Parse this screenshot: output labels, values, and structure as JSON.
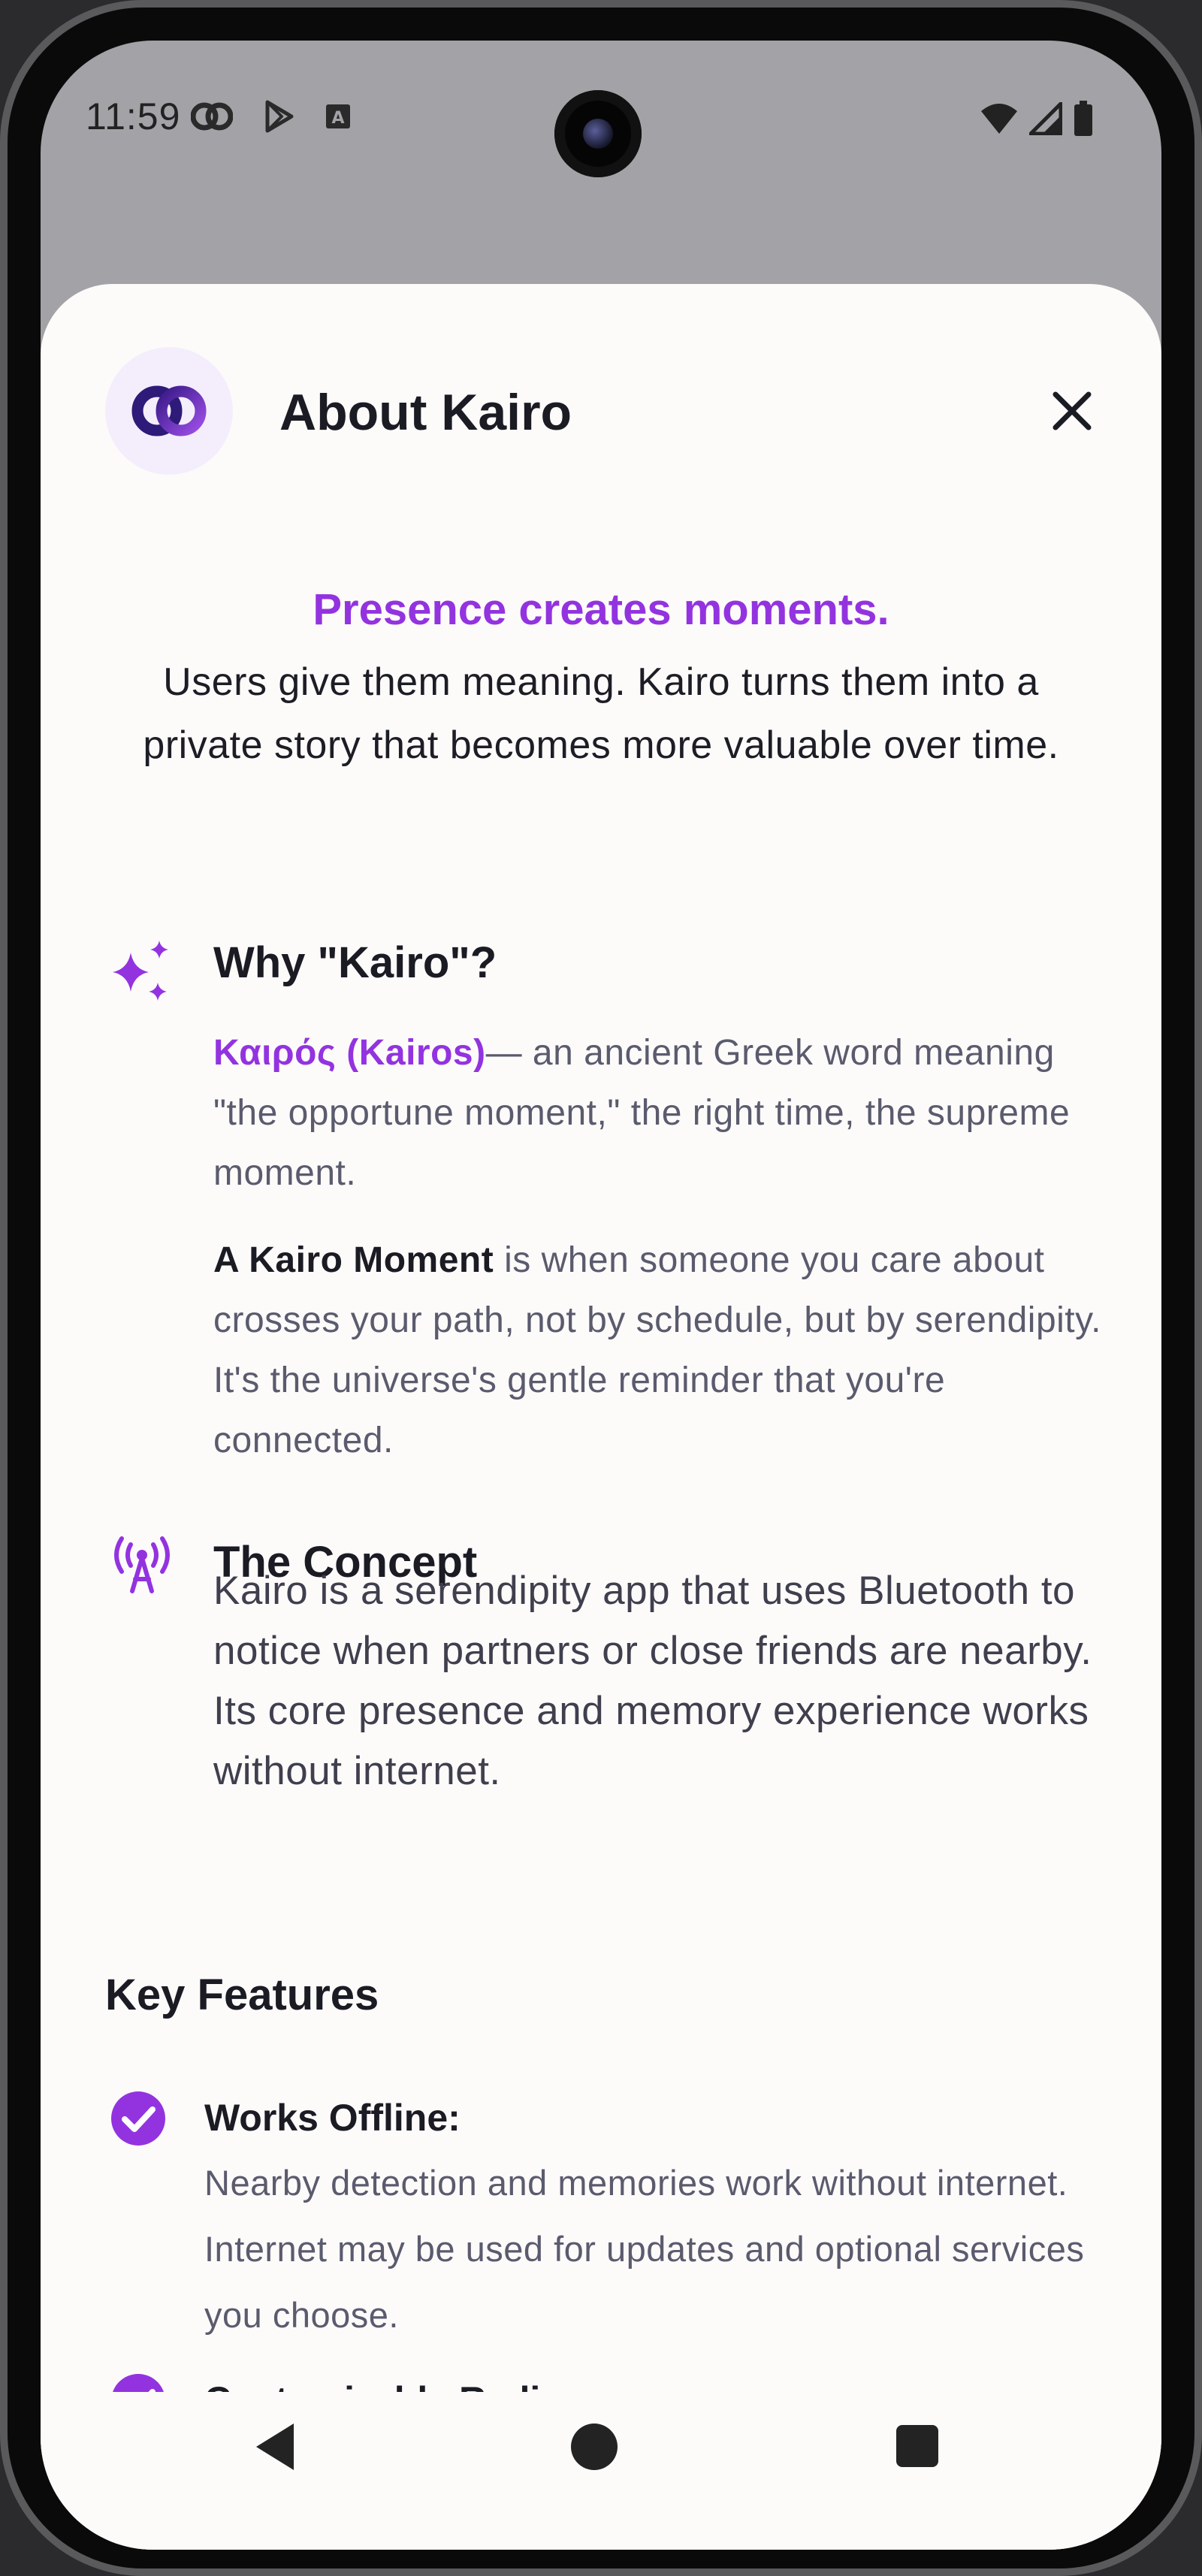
{
  "status_bar": {
    "time": "11:59",
    "left_icons": [
      "kairo-notification-icon",
      "play-store-icon",
      "keyboard-a-icon"
    ],
    "right_icons": [
      "wifi-icon",
      "signal-icon",
      "battery-icon"
    ]
  },
  "sheet": {
    "title": "About Kairo",
    "tagline": "Presence creates moments.",
    "intro": "Users give them meaning. Kairo turns them into a private story that becomes more valuable over time.",
    "why": {
      "title": "Why \"Kairo\"?",
      "term": "Καιρός (Kairos)",
      "definition": "— an ancient Greek word meaning \"the opportune moment,\" the right time, the supreme moment.",
      "moment_label": "A Kairo Moment",
      "moment_text": " is when someone you care about crosses your path, not by schedule, but by serendipity. It's the universe's gentle reminder that you're connected."
    },
    "concept": {
      "title": "The Concept",
      "text": "Kairo is a serendipity app that uses Bluetooth to notice when partners or close friends are nearby. Its core presence and memory experience works without internet."
    },
    "features": {
      "title": "Key Features",
      "items": [
        {
          "title": "Works Offline:",
          "desc": "Nearby detection and memories work without internet. Internet may be used for updates and optional services you choose."
        },
        {
          "title": "Customizable Radius:",
          "desc": ""
        }
      ]
    }
  },
  "colors": {
    "accent": "#9333e0",
    "sheet_bg": "#fdfbfa",
    "scrim": "#a3a2a7",
    "text_primary": "#1b1b24",
    "text_secondary": "#5b5b6e"
  }
}
